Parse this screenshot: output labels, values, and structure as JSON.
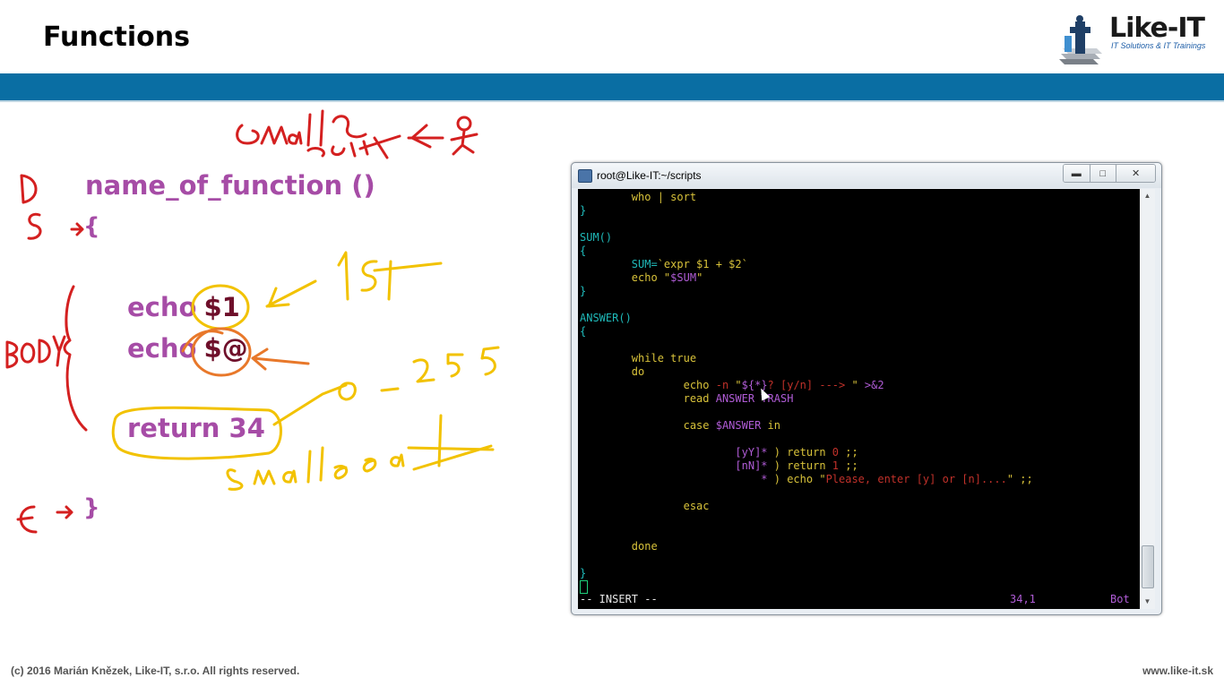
{
  "slide": {
    "title": "Functions"
  },
  "logo": {
    "name": "Like-IT",
    "tagline": "IT Solutions & IT Trainings"
  },
  "code": {
    "signature": "name_of_function ()",
    "open_brace": "{",
    "echo1_cmd": "echo",
    "echo1_arg": "$1",
    "echo2_cmd": "echo",
    "echo2_arg": "$@",
    "return_stmt": "return 34",
    "close_brace": "}"
  },
  "terminal": {
    "title": "root@Like-IT:~/scripts",
    "lines": [
      {
        "segments": [
          {
            "t": "        "
          },
          {
            "t": "who | sort",
            "c": "y"
          }
        ]
      },
      {
        "segments": [
          {
            "t": "}",
            "c": "c"
          }
        ]
      },
      {
        "segments": [
          {
            "t": ""
          }
        ]
      },
      {
        "segments": [
          {
            "t": "SUM()",
            "c": "c"
          }
        ]
      },
      {
        "segments": [
          {
            "t": "{",
            "c": "c"
          }
        ]
      },
      {
        "segments": [
          {
            "t": "        "
          },
          {
            "t": "SUM=",
            "c": "c"
          },
          {
            "t": "`expr $1 + $2`",
            "c": "y"
          }
        ]
      },
      {
        "segments": [
          {
            "t": "        "
          },
          {
            "t": "echo ",
            "c": "y"
          },
          {
            "t": "\"",
            "c": "y"
          },
          {
            "t": "$SUM",
            "c": "m"
          },
          {
            "t": "\"",
            "c": "y"
          }
        ]
      },
      {
        "segments": [
          {
            "t": "}",
            "c": "c"
          }
        ]
      },
      {
        "segments": [
          {
            "t": ""
          }
        ]
      },
      {
        "segments": [
          {
            "t": "ANSWER()",
            "c": "c"
          }
        ]
      },
      {
        "segments": [
          {
            "t": "{",
            "c": "c"
          }
        ]
      },
      {
        "segments": [
          {
            "t": ""
          }
        ]
      },
      {
        "segments": [
          {
            "t": "        "
          },
          {
            "t": "while true",
            "c": "y"
          }
        ]
      },
      {
        "segments": [
          {
            "t": "        "
          },
          {
            "t": "do",
            "c": "y"
          }
        ]
      },
      {
        "segments": [
          {
            "t": "                "
          },
          {
            "t": "echo ",
            "c": "y"
          },
          {
            "t": "-n ",
            "c": "r"
          },
          {
            "t": "\"",
            "c": "y"
          },
          {
            "t": "${*}",
            "c": "m"
          },
          {
            "t": "? [y/n] ---> ",
            "c": "r"
          },
          {
            "t": "\" ",
            "c": "y"
          },
          {
            "t": ">&2",
            "c": "m"
          }
        ]
      },
      {
        "segments": [
          {
            "t": "                "
          },
          {
            "t": "read ",
            "c": "y"
          },
          {
            "t": "ANSWER TRASH",
            "c": "m"
          }
        ]
      },
      {
        "segments": [
          {
            "t": ""
          }
        ]
      },
      {
        "segments": [
          {
            "t": "                "
          },
          {
            "t": "case ",
            "c": "y"
          },
          {
            "t": "$ANSWER",
            "c": "m"
          },
          {
            "t": " in",
            "c": "y"
          }
        ]
      },
      {
        "segments": [
          {
            "t": ""
          }
        ]
      },
      {
        "segments": [
          {
            "t": "                        "
          },
          {
            "t": "[yY]* ",
            "c": "m"
          },
          {
            "t": ") return ",
            "c": "y"
          },
          {
            "t": "0",
            "c": "r"
          },
          {
            "t": " ;;",
            "c": "y"
          }
        ]
      },
      {
        "segments": [
          {
            "t": "                        "
          },
          {
            "t": "[nN]* ",
            "c": "m"
          },
          {
            "t": ") return ",
            "c": "y"
          },
          {
            "t": "1",
            "c": "r"
          },
          {
            "t": " ;;",
            "c": "y"
          }
        ]
      },
      {
        "segments": [
          {
            "t": "                            "
          },
          {
            "t": "* ",
            "c": "m"
          },
          {
            "t": ") echo ",
            "c": "y"
          },
          {
            "t": "\"",
            "c": "y"
          },
          {
            "t": "Please, enter [y] or [n]....",
            "c": "r"
          },
          {
            "t": "\" ;;",
            "c": "y"
          }
        ]
      },
      {
        "segments": [
          {
            "t": ""
          }
        ]
      },
      {
        "segments": [
          {
            "t": "                "
          },
          {
            "t": "esac",
            "c": "y"
          }
        ]
      },
      {
        "segments": [
          {
            "t": ""
          }
        ]
      },
      {
        "segments": [
          {
            "t": ""
          }
        ]
      },
      {
        "segments": [
          {
            "t": "        "
          },
          {
            "t": "done",
            "c": "y"
          }
        ]
      },
      {
        "segments": [
          {
            "t": ""
          }
        ]
      },
      {
        "segments": [
          {
            "t": "}",
            "c": "c"
          }
        ]
      }
    ],
    "status_mode": "-- INSERT --",
    "status_pos": "34,1",
    "status_scroll": "Bot"
  },
  "footer": {
    "copyright": "(c) 2016 Marián Knězek, Like-IT, s.r.o. All rights reserved.",
    "url": "www.like-it.sk"
  },
  "colors": {
    "band": "#0a6ea3",
    "code_purple": "#a64ca6",
    "ink_red": "#d42020",
    "ink_yellow": "#f2c200",
    "ink_orange": "#e8782a"
  }
}
